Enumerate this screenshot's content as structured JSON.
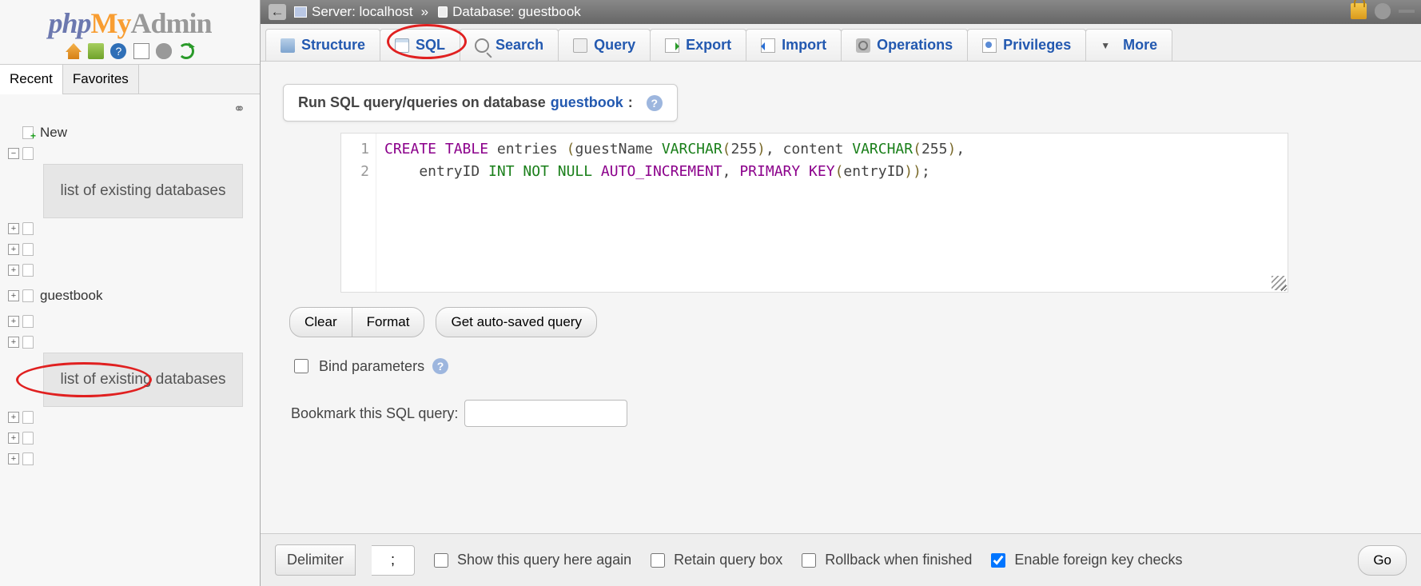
{
  "logo": {
    "php": "php",
    "my": "My",
    "admin": "Admin"
  },
  "sidebar_icons": [
    "home",
    "exit",
    "help",
    "doc",
    "gear",
    "reload"
  ],
  "side_tabs": {
    "recent": "Recent",
    "favorites": "Favorites"
  },
  "tree": {
    "new": "New",
    "placeholder": "list of existing databases",
    "selected_db": "guestbook"
  },
  "breadcrumb": {
    "server_label": "Server:",
    "server_value": "localhost",
    "database_label": "Database:",
    "database_value": "guestbook"
  },
  "tabs": {
    "structure": "Structure",
    "sql": "SQL",
    "search": "Search",
    "query": "Query",
    "export": "Export",
    "import": "Import",
    "operations": "Operations",
    "privileges": "Privileges",
    "more": "More"
  },
  "box": {
    "prefix": "Run SQL query/queries on database ",
    "dbname": "guestbook",
    "suffix": ":"
  },
  "code": {
    "line1": {
      "a": "CREATE TABLE",
      "b": " entries ",
      "p1": "(",
      "c": "guestName ",
      "d": "VARCHAR",
      "p2": "(",
      "e": "255",
      "p3": ")",
      "f": ", content ",
      "g": "VARCHAR",
      "p4": "(",
      "h": "255",
      "p5": ")",
      "i": ","
    },
    "line2": {
      "a": "    entryID ",
      "b": "INT NOT NULL",
      "c": " AUTO_INCREMENT",
      "d": ", ",
      "e": "PRIMARY KEY",
      "p1": "(",
      "f": "entryID",
      "p2": "))",
      "g": ";"
    }
  },
  "buttons": {
    "clear": "Clear",
    "format": "Format",
    "autosaved": "Get auto-saved query"
  },
  "bind_params": "Bind parameters",
  "bookmark_label": "Bookmark this SQL query:",
  "footer": {
    "delimiter_label": "Delimiter",
    "delimiter_value": ";",
    "show_again": "Show this query here again",
    "retain": "Retain query box",
    "rollback": "Rollback when finished",
    "fk": "Enable foreign key checks",
    "go": "Go"
  }
}
